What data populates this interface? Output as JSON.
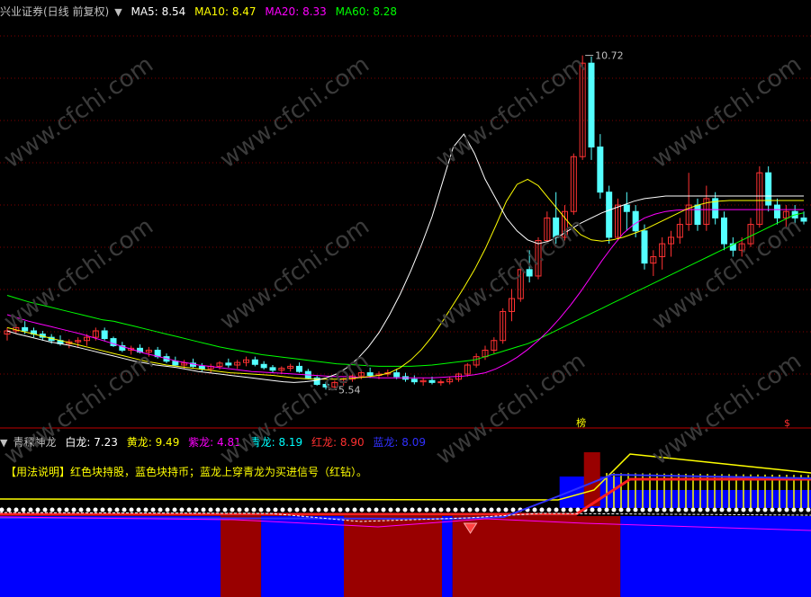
{
  "main_header": {
    "title": "兴业证券(日线 前复权)",
    "items": [
      {
        "label": "MA5:",
        "value": "8.54",
        "color": "#ffffff"
      },
      {
        "label": "MA10:",
        "value": "8.47",
        "color": "#ffff00"
      },
      {
        "label": "MA20:",
        "value": "8.33",
        "color": "#ff00ff"
      },
      {
        "label": "MA60:",
        "value": "8.28",
        "color": "#00ff00"
      }
    ]
  },
  "sub_header": {
    "title": "青稞神龙",
    "items": [
      {
        "label": "白龙:",
        "value": "7.23",
        "color": "#ffffff"
      },
      {
        "label": "黄龙:",
        "value": "9.49",
        "color": "#ffff00"
      },
      {
        "label": "紫龙:",
        "value": "4.81",
        "color": "#ff00ff"
      },
      {
        "label": "青龙:",
        "value": "8.19",
        "color": "#00ffff"
      },
      {
        "label": "红龙:",
        "value": "8.90",
        "color": "#ff3030"
      },
      {
        "label": "蓝龙:",
        "value": "8.09",
        "color": "#3030ff"
      }
    ]
  },
  "usage_note": "【用法说明】红色块持股，蓝色块持币；蓝龙上穿青龙为买进信号（红钻）。",
  "markers": {
    "bang": "榜",
    "dollar": "$"
  },
  "watermark": "www.cfchi.com",
  "colors": {
    "up": "#ff3232",
    "down": "#54ffff",
    "grid": "#800000",
    "hold": "#990000",
    "cash": "#0000ff"
  },
  "chart_data": {
    "type": "candlestick",
    "ylim": [
      5.0,
      11.3
    ],
    "annotations": [
      {
        "text": "10.72",
        "value": 10.72,
        "label": "high"
      },
      {
        "text": "5.54",
        "value": 5.54,
        "label": "low"
      }
    ],
    "candles": [
      [
        6.4,
        6.5,
        6.3,
        6.45
      ],
      [
        6.45,
        6.55,
        6.4,
        6.5
      ],
      [
        6.5,
        6.6,
        6.4,
        6.45
      ],
      [
        6.45,
        6.5,
        6.35,
        6.4
      ],
      [
        6.4,
        6.45,
        6.3,
        6.35
      ],
      [
        6.35,
        6.4,
        6.25,
        6.3
      ],
      [
        6.3,
        6.38,
        6.22,
        6.25
      ],
      [
        6.25,
        6.32,
        6.18,
        6.28
      ],
      [
        6.28,
        6.35,
        6.2,
        6.3
      ],
      [
        6.3,
        6.4,
        6.22,
        6.35
      ],
      [
        6.35,
        6.5,
        6.3,
        6.45
      ],
      [
        6.45,
        6.5,
        6.3,
        6.33
      ],
      [
        6.33,
        6.36,
        6.2,
        6.22
      ],
      [
        6.22,
        6.28,
        6.12,
        6.15
      ],
      [
        6.15,
        6.22,
        6.08,
        6.18
      ],
      [
        6.18,
        6.24,
        6.1,
        6.12
      ],
      [
        6.12,
        6.2,
        6.05,
        6.15
      ],
      [
        6.15,
        6.2,
        6.02,
        6.05
      ],
      [
        6.05,
        6.1,
        5.95,
        5.98
      ],
      [
        5.98,
        6.05,
        5.9,
        5.92
      ],
      [
        5.92,
        6.0,
        5.86,
        5.95
      ],
      [
        5.95,
        6.02,
        5.88,
        5.9
      ],
      [
        5.9,
        5.95,
        5.82,
        5.86
      ],
      [
        5.86,
        5.94,
        5.8,
        5.9
      ],
      [
        5.9,
        5.98,
        5.85,
        5.95
      ],
      [
        5.95,
        6.02,
        5.88,
        5.92
      ],
      [
        5.92,
        6.0,
        5.86,
        5.96
      ],
      [
        5.96,
        6.05,
        5.9,
        6.0
      ],
      [
        6.0,
        6.05,
        5.9,
        5.93
      ],
      [
        5.93,
        5.98,
        5.85,
        5.88
      ],
      [
        5.88,
        5.92,
        5.8,
        5.84
      ],
      [
        5.84,
        5.9,
        5.78,
        5.87
      ],
      [
        5.87,
        5.94,
        5.82,
        5.9
      ],
      [
        5.9,
        5.96,
        5.8,
        5.82
      ],
      [
        5.82,
        5.86,
        5.7,
        5.72
      ],
      [
        5.72,
        5.76,
        5.6,
        5.62
      ],
      [
        5.62,
        5.66,
        5.54,
        5.58
      ],
      [
        5.58,
        5.68,
        5.56,
        5.65
      ],
      [
        5.65,
        5.72,
        5.6,
        5.7
      ],
      [
        5.7,
        5.8,
        5.66,
        5.75
      ],
      [
        5.75,
        5.85,
        5.7,
        5.8
      ],
      [
        5.8,
        5.88,
        5.72,
        5.76
      ],
      [
        5.76,
        5.82,
        5.7,
        5.78
      ],
      [
        5.78,
        5.85,
        5.74,
        5.8
      ],
      [
        5.8,
        5.86,
        5.7,
        5.74
      ],
      [
        5.74,
        5.8,
        5.66,
        5.7
      ],
      [
        5.7,
        5.76,
        5.62,
        5.66
      ],
      [
        5.66,
        5.72,
        5.6,
        5.68
      ],
      [
        5.68,
        5.74,
        5.62,
        5.65
      ],
      [
        5.65,
        5.7,
        5.6,
        5.66
      ],
      [
        5.66,
        5.74,
        5.62,
        5.7
      ],
      [
        5.7,
        5.8,
        5.66,
        5.78
      ],
      [
        5.78,
        5.95,
        5.74,
        5.92
      ],
      [
        5.92,
        6.1,
        5.88,
        6.05
      ],
      [
        6.05,
        6.22,
        6.0,
        6.15
      ],
      [
        6.15,
        6.35,
        6.1,
        6.3
      ],
      [
        6.3,
        6.8,
        6.25,
        6.75
      ],
      [
        6.75,
        7.1,
        6.6,
        6.95
      ],
      [
        6.95,
        7.5,
        6.9,
        7.4
      ],
      [
        7.4,
        7.7,
        7.2,
        7.3
      ],
      [
        7.3,
        7.9,
        7.25,
        7.85
      ],
      [
        7.85,
        8.3,
        7.8,
        8.2
      ],
      [
        8.2,
        8.6,
        7.8,
        7.9
      ],
      [
        7.9,
        8.4,
        7.85,
        8.3
      ],
      [
        8.3,
        9.2,
        8.25,
        9.15
      ],
      [
        9.15,
        10.72,
        9.1,
        10.6
      ],
      [
        10.6,
        10.7,
        9.1,
        9.3
      ],
      [
        9.3,
        9.5,
        8.5,
        8.6
      ],
      [
        8.6,
        8.7,
        7.8,
        7.9
      ],
      [
        7.9,
        8.5,
        7.85,
        8.4
      ],
      [
        8.4,
        8.6,
        8.0,
        8.3
      ],
      [
        8.3,
        8.4,
        7.9,
        8.0
      ],
      [
        8.0,
        8.1,
        7.4,
        7.5
      ],
      [
        7.5,
        7.7,
        7.3,
        7.6
      ],
      [
        7.6,
        7.9,
        7.4,
        7.8
      ],
      [
        7.8,
        8.0,
        7.6,
        7.9
      ],
      [
        7.9,
        8.2,
        7.8,
        8.1
      ],
      [
        8.1,
        8.9,
        8.0,
        8.4
      ],
      [
        8.4,
        8.5,
        8.0,
        8.1
      ],
      [
        8.1,
        8.7,
        8.0,
        8.5
      ],
      [
        8.5,
        8.6,
        8.1,
        8.2
      ],
      [
        8.2,
        8.3,
        7.7,
        7.8
      ],
      [
        7.8,
        7.9,
        7.6,
        7.7
      ],
      [
        7.7,
        7.9,
        7.6,
        7.8
      ],
      [
        7.8,
        8.2,
        7.75,
        8.1
      ],
      [
        8.1,
        9.0,
        8.05,
        8.9
      ],
      [
        8.9,
        9.0,
        8.3,
        8.4
      ],
      [
        8.4,
        8.5,
        8.1,
        8.2
      ],
      [
        8.2,
        8.4,
        8.05,
        8.3
      ],
      [
        8.3,
        8.4,
        8.1,
        8.2
      ],
      [
        8.2,
        8.3,
        8.1,
        8.15
      ]
    ],
    "series": [
      {
        "name": "MA60",
        "color": "#00ff00",
        "values": [
          7.0,
          6.95,
          6.9,
          6.86,
          6.82,
          6.78,
          6.74,
          6.7,
          6.66,
          6.62,
          6.6,
          6.56,
          6.52,
          6.48,
          6.44,
          6.4,
          6.36,
          6.32,
          6.28,
          6.24,
          6.2,
          6.17,
          6.14,
          6.11,
          6.08,
          6.06,
          6.04,
          6.02,
          6.0,
          5.98,
          5.96,
          5.94,
          5.93,
          5.92,
          5.91,
          5.9,
          5.9,
          5.9,
          5.9,
          5.91,
          5.92,
          5.94,
          5.96,
          5.98,
          6.0,
          6.05,
          6.1,
          6.15,
          6.2,
          6.25,
          6.32,
          6.4,
          6.48,
          6.56,
          6.64,
          6.72,
          6.8,
          6.88,
          6.96,
          7.04,
          7.12,
          7.2,
          7.28,
          7.36,
          7.44,
          7.52,
          7.6,
          7.68,
          7.76,
          7.84,
          7.92,
          8.0,
          8.08,
          8.16,
          8.24,
          8.28
        ]
      },
      {
        "name": "MA20",
        "color": "#ff00ff",
        "values": [
          6.7,
          6.65,
          6.6,
          6.56,
          6.52,
          6.48,
          6.44,
          6.4,
          6.35,
          6.3,
          6.25,
          6.2,
          6.15,
          6.1,
          6.06,
          6.02,
          5.98,
          5.95,
          5.92,
          5.9,
          5.88,
          5.86,
          5.84,
          5.82,
          5.81,
          5.8,
          5.79,
          5.78,
          5.77,
          5.76,
          5.75,
          5.74,
          5.74,
          5.73,
          5.73,
          5.72,
          5.72,
          5.72,
          5.72,
          5.72,
          5.72,
          5.73,
          5.74,
          5.75,
          5.77,
          5.8,
          5.86,
          5.94,
          6.04,
          6.16,
          6.3,
          6.46,
          6.64,
          6.84,
          7.06,
          7.3,
          7.54,
          7.76,
          7.96,
          8.1,
          8.2,
          8.26,
          8.3,
          8.32,
          8.33,
          8.33,
          8.33,
          8.33,
          8.33,
          8.33,
          8.33,
          8.33,
          8.33,
          8.33,
          8.33,
          8.33
        ]
      },
      {
        "name": "MA10",
        "color": "#ffff00",
        "values": [
          6.5,
          6.46,
          6.42,
          6.38,
          6.34,
          6.3,
          6.26,
          6.22,
          6.18,
          6.14,
          6.1,
          6.06,
          6.02,
          5.98,
          5.95,
          5.92,
          5.9,
          5.88,
          5.86,
          5.84,
          5.82,
          5.8,
          5.79,
          5.78,
          5.77,
          5.76,
          5.74,
          5.72,
          5.71,
          5.7,
          5.7,
          5.7,
          5.71,
          5.72,
          5.74,
          5.76,
          5.8,
          5.88,
          6.0,
          6.16,
          6.36,
          6.6,
          6.86,
          7.12,
          7.4,
          7.72,
          8.08,
          8.46,
          8.72,
          8.8,
          8.7,
          8.5,
          8.3,
          8.1,
          7.94,
          7.86,
          7.84,
          7.86,
          7.9,
          7.96,
          8.02,
          8.1,
          8.18,
          8.26,
          8.34,
          8.4,
          8.44,
          8.46,
          8.47,
          8.47,
          8.47,
          8.47,
          8.47,
          8.47,
          8.47,
          8.47
        ]
      },
      {
        "name": "MA5",
        "color": "#ffffff",
        "values": [
          6.45,
          6.4,
          6.36,
          6.32,
          6.28,
          6.25,
          6.22,
          6.18,
          6.14,
          6.1,
          6.06,
          6.02,
          5.98,
          5.95,
          5.92,
          5.9,
          5.88,
          5.85,
          5.82,
          5.8,
          5.78,
          5.76,
          5.74,
          5.72,
          5.7,
          5.68,
          5.66,
          5.65,
          5.66,
          5.68,
          5.72,
          5.78,
          5.88,
          6.02,
          6.2,
          6.42,
          6.7,
          7.02,
          7.38,
          7.78,
          8.22,
          8.76,
          9.3,
          9.5,
          9.2,
          8.8,
          8.5,
          8.2,
          8.0,
          7.86,
          7.8,
          7.84,
          7.92,
          8.02,
          8.12,
          8.2,
          8.28,
          8.34,
          8.4,
          8.46,
          8.5,
          8.52,
          8.54,
          8.54,
          8.54,
          8.54,
          8.54,
          8.54,
          8.54,
          8.54,
          8.54,
          8.54,
          8.54,
          8.54,
          8.54,
          8.54
        ]
      }
    ],
    "indicator": {
      "blocks": [
        {
          "state": "cash",
          "from": 0,
          "to": 0.272
        },
        {
          "state": "hold",
          "from": 0.272,
          "to": 0.322
        },
        {
          "state": "cash",
          "from": 0.322,
          "to": 0.424
        },
        {
          "state": "hold",
          "from": 0.424,
          "to": 0.545
        },
        {
          "state": "cash",
          "from": 0.545,
          "to": 0.558
        },
        {
          "state": "hold",
          "from": 0.558,
          "to": 0.765
        },
        {
          "state": "cash",
          "from": 0.765,
          "to": 1.0
        }
      ],
      "signal": {
        "label": "red-diamond",
        "at": 0.58
      }
    }
  }
}
